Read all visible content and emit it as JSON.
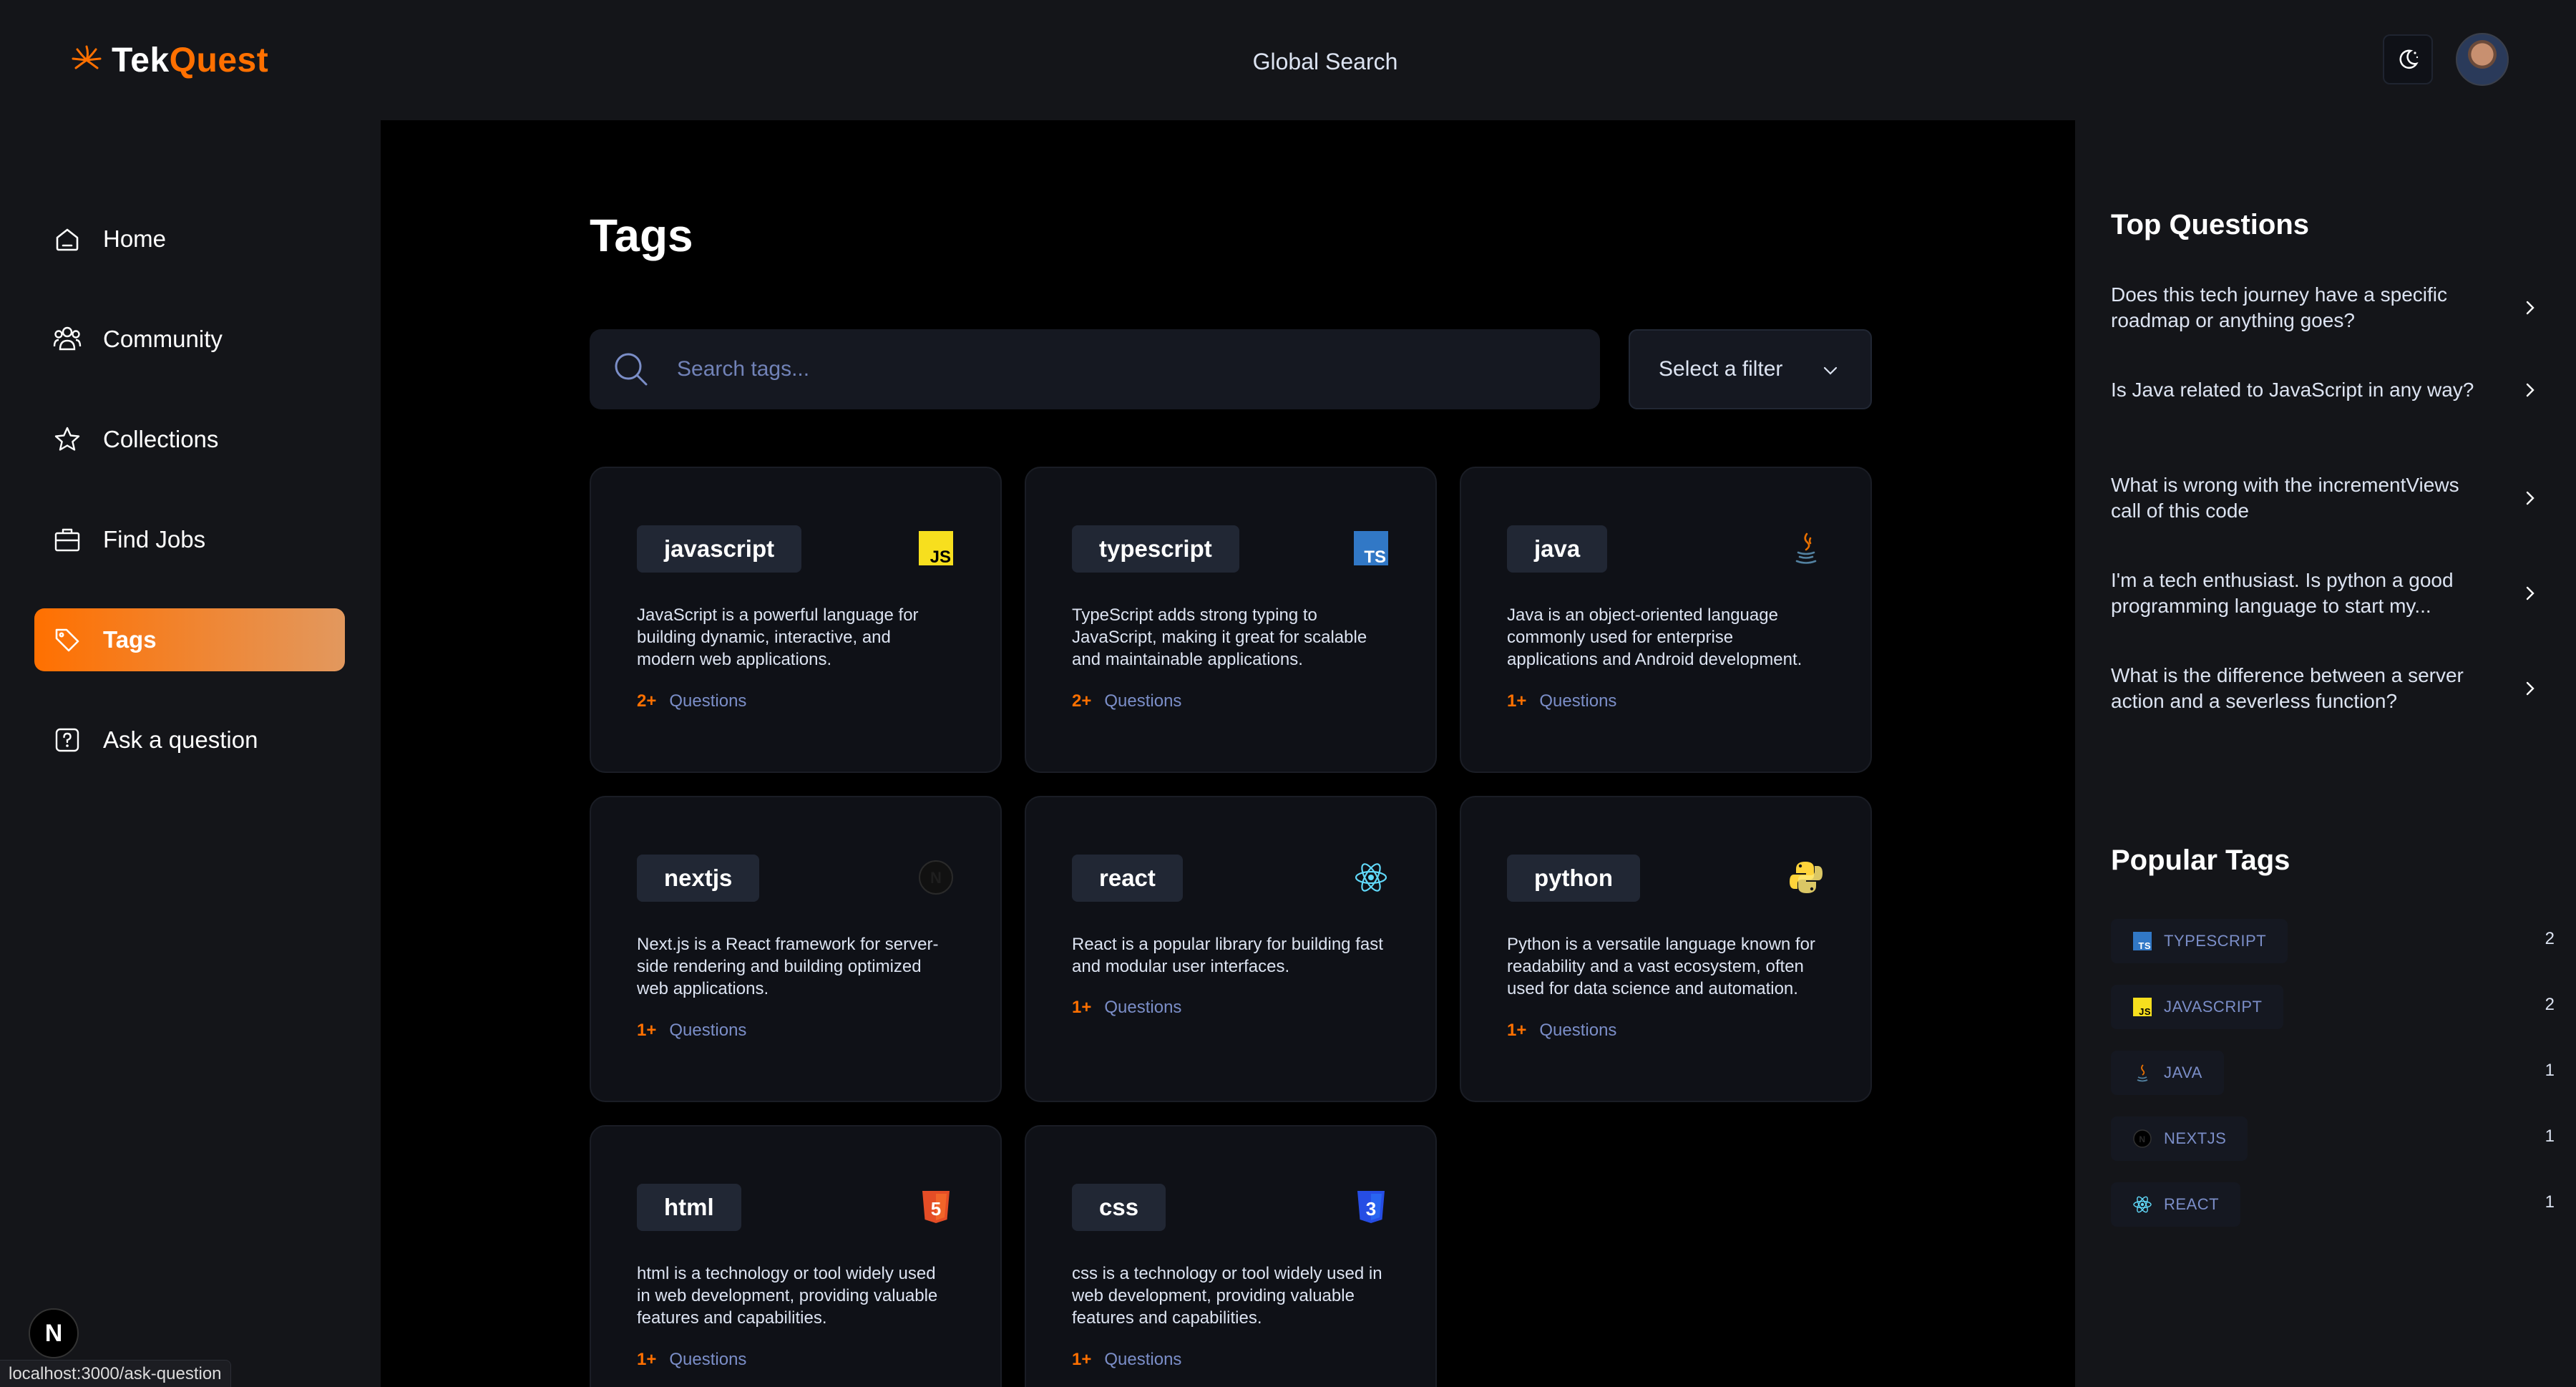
{
  "brand": {
    "part1": "Tek",
    "part2": "Quest"
  },
  "header": {
    "global_search": "Global Search"
  },
  "sidebar": {
    "items": [
      {
        "label": "Home",
        "icon": "home-icon"
      },
      {
        "label": "Community",
        "icon": "users-icon"
      },
      {
        "label": "Collections",
        "icon": "star-icon"
      },
      {
        "label": "Find Jobs",
        "icon": "briefcase-icon"
      },
      {
        "label": "Tags",
        "icon": "tag-icon",
        "active": true
      },
      {
        "label": "Ask a question",
        "icon": "question-icon"
      }
    ]
  },
  "main": {
    "title": "Tags",
    "search": {
      "placeholder": "Search tags..."
    },
    "filter": {
      "label": "Select a filter"
    },
    "tags": [
      {
        "name": "javascript",
        "icon": "js-icon",
        "desc": "JavaScript is a powerful language for building dynamic, interactive, and modern web applications.",
        "count": "2+",
        "count_label": "Questions"
      },
      {
        "name": "typescript",
        "icon": "ts-icon",
        "desc": "TypeScript adds strong typing to JavaScript, making it great for scalable and maintainable applications.",
        "count": "2+",
        "count_label": "Questions"
      },
      {
        "name": "java",
        "icon": "java-icon",
        "desc": "Java is an object-oriented language commonly used for enterprise applications and Android development.",
        "count": "1+",
        "count_label": "Questions"
      },
      {
        "name": "nextjs",
        "icon": "nextjs-icon",
        "desc": "Next.js is a React framework for server-side rendering and building optimized web applications.",
        "count": "1+",
        "count_label": "Questions"
      },
      {
        "name": "react",
        "icon": "react-icon",
        "desc": "React is a popular library for building fast and modular user interfaces.",
        "count": "1+",
        "count_label": "Questions"
      },
      {
        "name": "python",
        "icon": "python-icon",
        "desc": "Python is a versatile language known for readability and a vast ecosystem, often used for data science and automation.",
        "count": "1+",
        "count_label": "Questions"
      },
      {
        "name": "html",
        "icon": "html5-icon",
        "desc": "html is a technology or tool widely used in web development, providing valuable features and capabilities.",
        "count": "1+",
        "count_label": "Questions"
      },
      {
        "name": "css",
        "icon": "css3-icon",
        "desc": "css is a technology or tool widely used in web development, providing valuable features and capabilities.",
        "count": "1+",
        "count_label": "Questions"
      }
    ]
  },
  "right": {
    "top_questions_title": "Top Questions",
    "top_questions": [
      "Does this tech journey have a specific roadmap or anything goes?",
      "Is Java related to JavaScript in any way?",
      "What is wrong with the incrementViews call of this code",
      "I'm a tech enthusiast. Is python a good programming language to start my...",
      "What is the difference between a server action and a severless function?"
    ],
    "popular_tags_title": "Popular Tags",
    "popular_tags": [
      {
        "name": "TYPESCRIPT",
        "count": "2",
        "icon": "ts-icon"
      },
      {
        "name": "JAVASCRIPT",
        "count": "2",
        "icon": "js-icon"
      },
      {
        "name": "JAVA",
        "count": "1",
        "icon": "java-icon"
      },
      {
        "name": "NEXTJS",
        "count": "1",
        "icon": "nextjs-icon"
      },
      {
        "name": "REACT",
        "count": "1",
        "icon": "react-icon"
      }
    ]
  },
  "dev": {
    "badge": "N",
    "status_url": "localhost:3000/ask-question"
  },
  "colors": {
    "accent": "#ff7000",
    "accent_end": "#e2985e",
    "muted": "#7b8ec8",
    "bg": "#000000",
    "panel": "#141519",
    "card": "#0f1117"
  }
}
